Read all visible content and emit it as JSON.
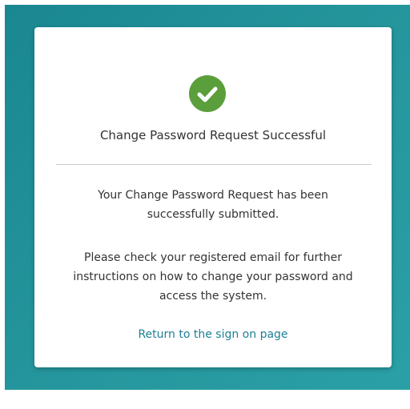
{
  "colors": {
    "background": "#1f8b93",
    "card": "#ffffff",
    "success": "#5b9e3c",
    "link": "#1f7f95",
    "text": "#333333"
  },
  "card": {
    "icon": "check-circle-icon",
    "title": "Change Password Request Successful",
    "message_line1": "Your Change Password Request has been",
    "message_line2": "successfully submitted.",
    "instructions_line1": "Please check your registered email for further",
    "instructions_line2": "instructions on how to change your password and",
    "instructions_line3": "access the system.",
    "return_link": "Return to the sign on page"
  }
}
